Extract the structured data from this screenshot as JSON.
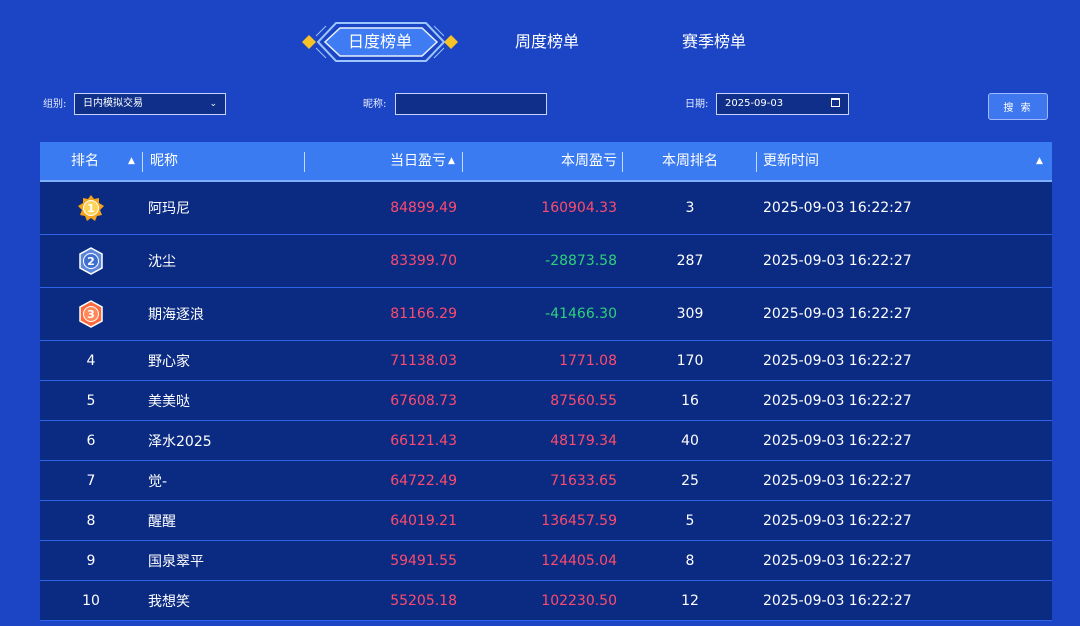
{
  "tabs": {
    "daily": "日度榜单",
    "weekly": "周度榜单",
    "season": "赛季榜单"
  },
  "filters": {
    "group_label": "组别:",
    "group_value": "日内模拟交易",
    "nickname_label": "昵称:",
    "nickname_value": "",
    "date_label": "日期:",
    "date_value": "2025-09-03",
    "search_label": "搜 索"
  },
  "table": {
    "headers": {
      "rank": "排名",
      "nickname": "昵称",
      "daily_pnl": "当日盈亏",
      "weekly_pnl": "本周盈亏",
      "weekly_rank": "本周排名",
      "updated": "更新时间"
    },
    "rows": [
      {
        "rank": "1",
        "nickname": "阿玛尼",
        "daily_pnl": "84899.49",
        "weekly_pnl": "160904.33",
        "weekly_rank": "3",
        "updated": "2025-09-03 16:22:27"
      },
      {
        "rank": "2",
        "nickname": "沈尘",
        "daily_pnl": "83399.70",
        "weekly_pnl": "-28873.58",
        "weekly_rank": "287",
        "updated": "2025-09-03 16:22:27"
      },
      {
        "rank": "3",
        "nickname": "期海逐浪",
        "daily_pnl": "81166.29",
        "weekly_pnl": "-41466.30",
        "weekly_rank": "309",
        "updated": "2025-09-03 16:22:27"
      },
      {
        "rank": "4",
        "nickname": "野心家",
        "daily_pnl": "71138.03",
        "weekly_pnl": "1771.08",
        "weekly_rank": "170",
        "updated": "2025-09-03 16:22:27"
      },
      {
        "rank": "5",
        "nickname": "美美哒",
        "daily_pnl": "67608.73",
        "weekly_pnl": "87560.55",
        "weekly_rank": "16",
        "updated": "2025-09-03 16:22:27"
      },
      {
        "rank": "6",
        "nickname": "泽水2025",
        "daily_pnl": "66121.43",
        "weekly_pnl": "48179.34",
        "weekly_rank": "40",
        "updated": "2025-09-03 16:22:27"
      },
      {
        "rank": "7",
        "nickname": "觉-",
        "daily_pnl": "64722.49",
        "weekly_pnl": "71633.65",
        "weekly_rank": "25",
        "updated": "2025-09-03 16:22:27"
      },
      {
        "rank": "8",
        "nickname": "醒醒",
        "daily_pnl": "64019.21",
        "weekly_pnl": "136457.59",
        "weekly_rank": "5",
        "updated": "2025-09-03 16:22:27"
      },
      {
        "rank": "9",
        "nickname": "国泉翠平",
        "daily_pnl": "59491.55",
        "weekly_pnl": "124405.04",
        "weekly_rank": "8",
        "updated": "2025-09-03 16:22:27"
      },
      {
        "rank": "10",
        "nickname": "我想笑",
        "daily_pnl": "55205.18",
        "weekly_pnl": "102230.50",
        "weekly_rank": "12",
        "updated": "2025-09-03 16:22:27"
      }
    ]
  },
  "icons": {
    "sort": "sort-icon",
    "dropdown": "chevron-down-icon",
    "calendar": "calendar-icon",
    "medals": [
      "gold-medal-icon",
      "silver-medal-icon",
      "bronze-medal-icon"
    ]
  },
  "colors": {
    "background": "#1b45c4",
    "header": "#3a7bf2",
    "row": "#0b2b82",
    "positive": "#ff4a6d",
    "negative": "#2ed17a",
    "gold": "#f5a31a",
    "silver": "#5b86d9",
    "bronze": "#ff6a3d"
  }
}
